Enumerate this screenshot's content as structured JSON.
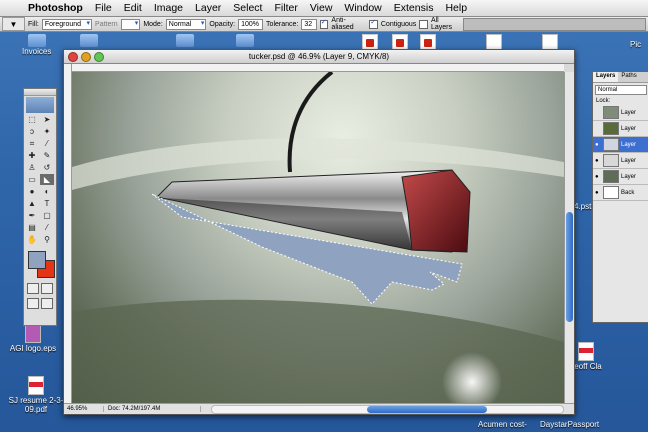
{
  "menubar": {
    "app": "Photoshop",
    "items": [
      "File",
      "Edit",
      "Image",
      "Layer",
      "Select",
      "Filter",
      "View",
      "Window",
      "Extensis",
      "Help"
    ]
  },
  "options": {
    "fill_label": "Fill:",
    "fill_value": "Foreground",
    "pattern_label": "Pattern",
    "mode_label": "Mode:",
    "mode_value": "Normal",
    "opacity_label": "Opacity:",
    "opacity_value": "100%",
    "tolerance_label": "Tolerance:",
    "tolerance_value": "32",
    "anti_aliased": "Anti-aliased",
    "contiguous": "Contiguous",
    "all_layers": "All Layers"
  },
  "window": {
    "title": "tucker.psd @ 46.9% (Layer 9, CMYK/8)",
    "zoom": "46.95%",
    "doc_size": "Doc: 74.2M/197.4M"
  },
  "layers_panel": {
    "tab_layers": "Layers",
    "tab_paths": "Paths",
    "blend_mode": "Normal",
    "lock_label": "Lock:",
    "rows": [
      "Layer",
      "Layer",
      "Layer",
      "Layer",
      "Layer",
      "Back"
    ]
  },
  "desktop": {
    "icons": [
      {
        "label": "Invoices"
      },
      {
        "label": "AGI logo.eps"
      },
      {
        "label": "SJ resume 2-3-09.pdf"
      },
      {
        "label": "Acumen cost-"
      },
      {
        "label": "DaystarPassport"
      },
      {
        "label": "ceoff Cla"
      },
      {
        "label": "4.pst"
      },
      {
        "label": "Pic"
      }
    ]
  },
  "colors": {
    "foreground": "#8fa3c0",
    "background": "#e53315",
    "selection_fill": "#8fa3c0"
  }
}
